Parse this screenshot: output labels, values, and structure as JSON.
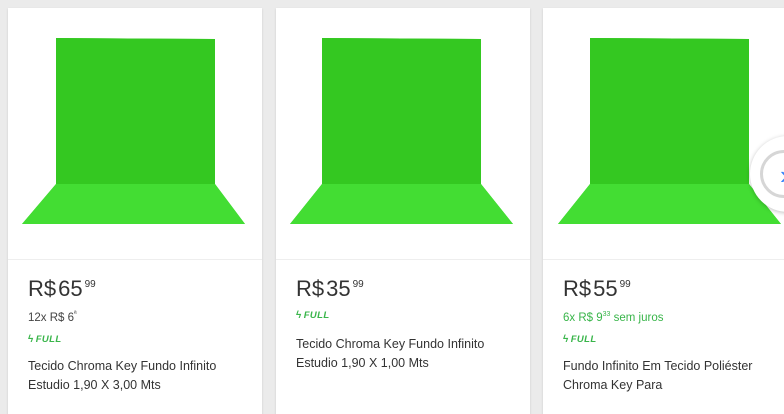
{
  "products": [
    {
      "price_currency": "R$",
      "price_int": "65",
      "price_cents": "99",
      "installments": "12x R$ 6",
      "installments_cents": "ª",
      "installments_suffix": "",
      "shipping_badge": "FULL",
      "title": "Tecido Chroma Key Fundo Infinito Estudio 1,90 X 3,00 Mts",
      "image_icon": "green-chroma-backdrop"
    },
    {
      "price_currency": "R$",
      "price_int": "35",
      "price_cents": "99",
      "shipping_badge": "FULL",
      "title": "Tecido Chroma Key Fundo Infinito Estudio 1,90 X 1,00 Mts",
      "image_icon": "green-chroma-backdrop"
    },
    {
      "price_currency": "R$",
      "price_int": "55",
      "price_cents": "99",
      "installments": "6x R$ 9",
      "installments_cents": "33",
      "installments_suffix": " sem juros",
      "shipping_badge": "FULL",
      "title": "Fundo Infinito Em Tecido Poliéster Chroma Key Para",
      "image_icon": "green-chroma-backdrop"
    }
  ],
  "carousel": {
    "next_icon": "chevron-right-icon"
  },
  "colors": {
    "backdrop_green": "#39d427",
    "full_green": "#39b54a",
    "price_text": "#333333",
    "page_bg": "#ebebeb"
  }
}
